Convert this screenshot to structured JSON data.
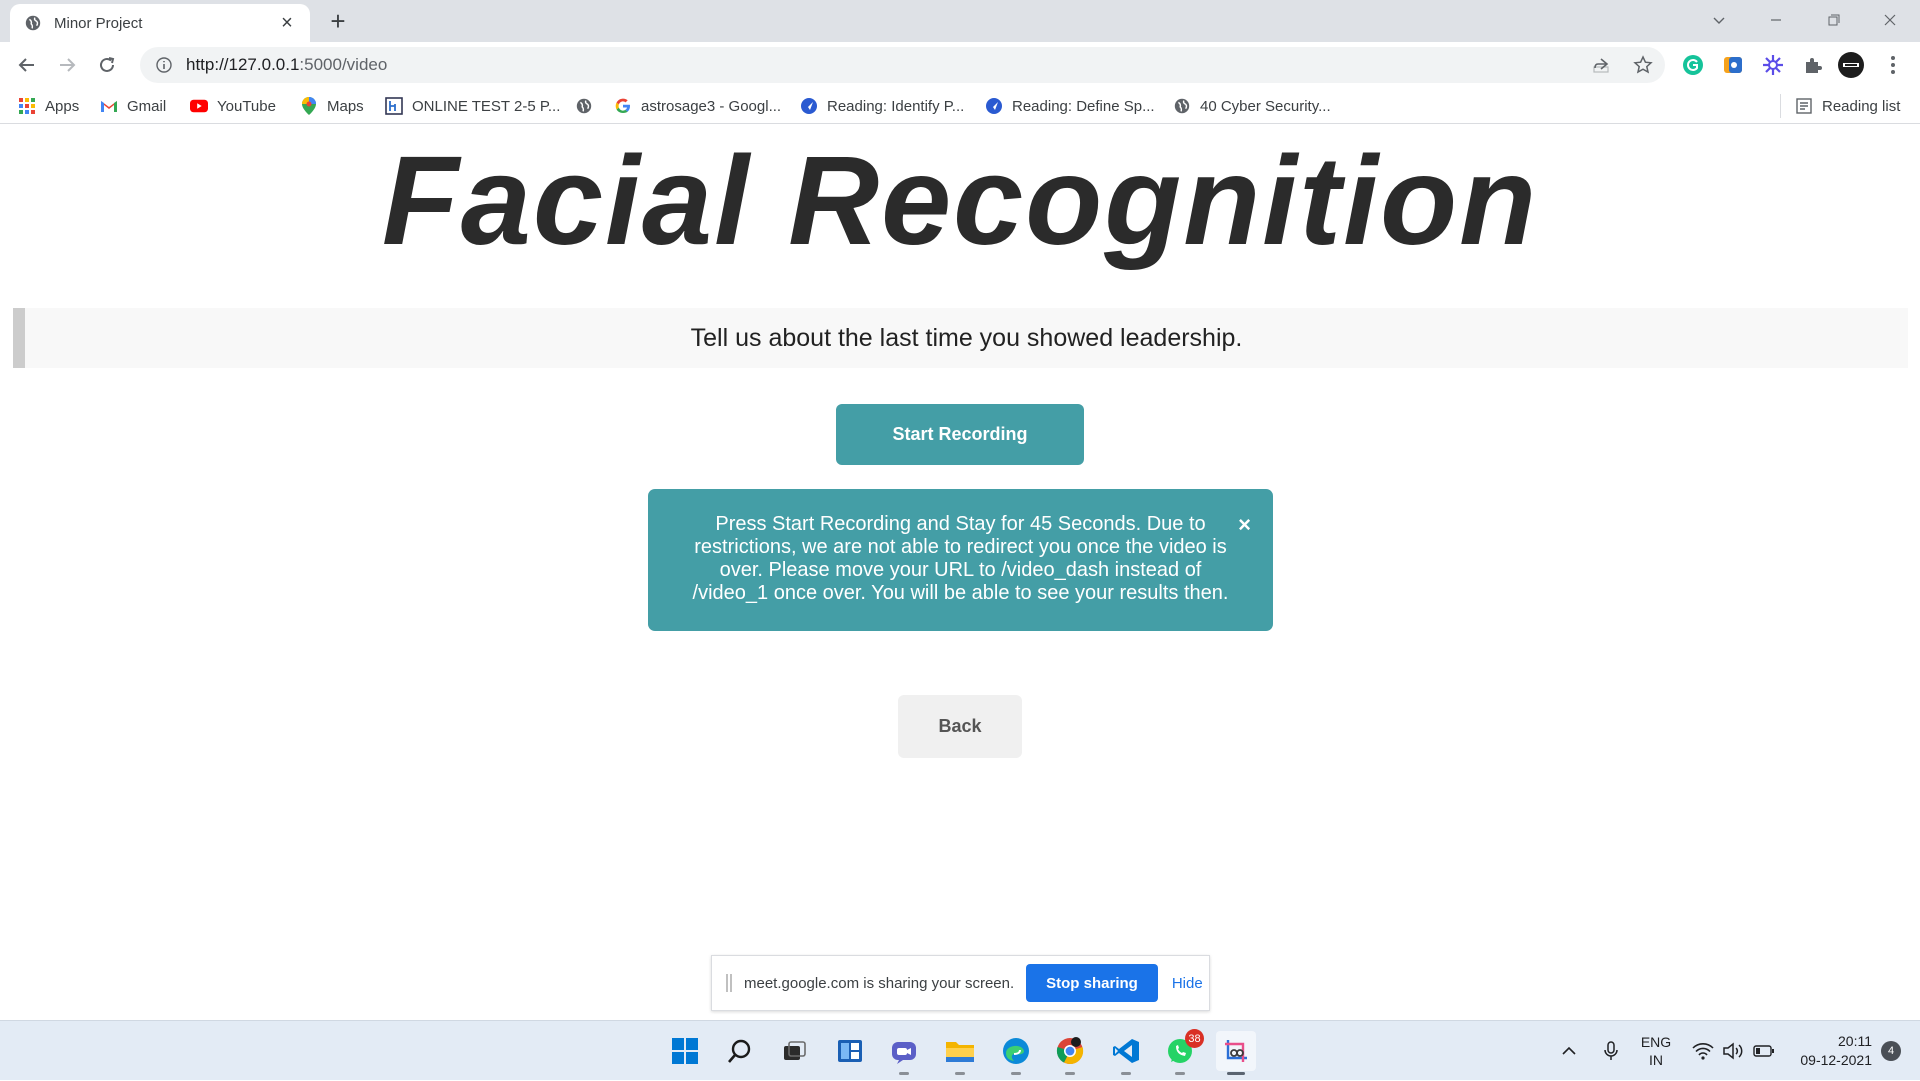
{
  "browser": {
    "tab_title": "Minor Project",
    "new_tab_label": "+",
    "url_host": "http://127.0.0.1",
    "url_rest": ":5000/video",
    "reading_list_label": "Reading list"
  },
  "bookmarks": [
    {
      "label": "Apps",
      "icon": "apps-grid-icon"
    },
    {
      "label": "Gmail",
      "icon": "gmail-icon"
    },
    {
      "label": "YouTube",
      "icon": "youtube-icon"
    },
    {
      "label": "Maps",
      "icon": "maps-icon"
    },
    {
      "label": "ONLINE TEST 2-5 P...",
      "icon": "hackerearth-icon"
    },
    {
      "label": "",
      "icon": "globe-icon"
    },
    {
      "label": "astrosage3 - Googl...",
      "icon": "google-icon"
    },
    {
      "label": "Reading: Identify P...",
      "icon": "pluralsight-icon"
    },
    {
      "label": "Reading: Define Sp...",
      "icon": "pluralsight-icon"
    },
    {
      "label": "40 Cyber Security...",
      "icon": "globe-icon"
    }
  ],
  "page": {
    "title": "Facial Recognition",
    "question": "Tell us about the last time you showed leadership.",
    "start_button": "Start Recording",
    "alert_text": "Press Start Recording and Stay for 45 Seconds. Due to restrictions, we are not able to redirect you once the video is over. Please move your URL to /video_dash instead of /video_1 once over. You will be able to see your results then.",
    "alert_close": "×",
    "back_button": "Back"
  },
  "sharebar": {
    "message": "meet.google.com is sharing your screen.",
    "stop_label": "Stop sharing",
    "hide_label": "Hide"
  },
  "taskbar": {
    "whatsapp_badge": "38",
    "lang_top": "ENG",
    "lang_bottom": "IN",
    "time": "20:11",
    "date": "09-12-2021",
    "notifications": "4"
  },
  "colors": {
    "accent_teal": "#449ea6",
    "stop_sharing_blue": "#1a73e8",
    "title_text": "#2b2b2b"
  }
}
